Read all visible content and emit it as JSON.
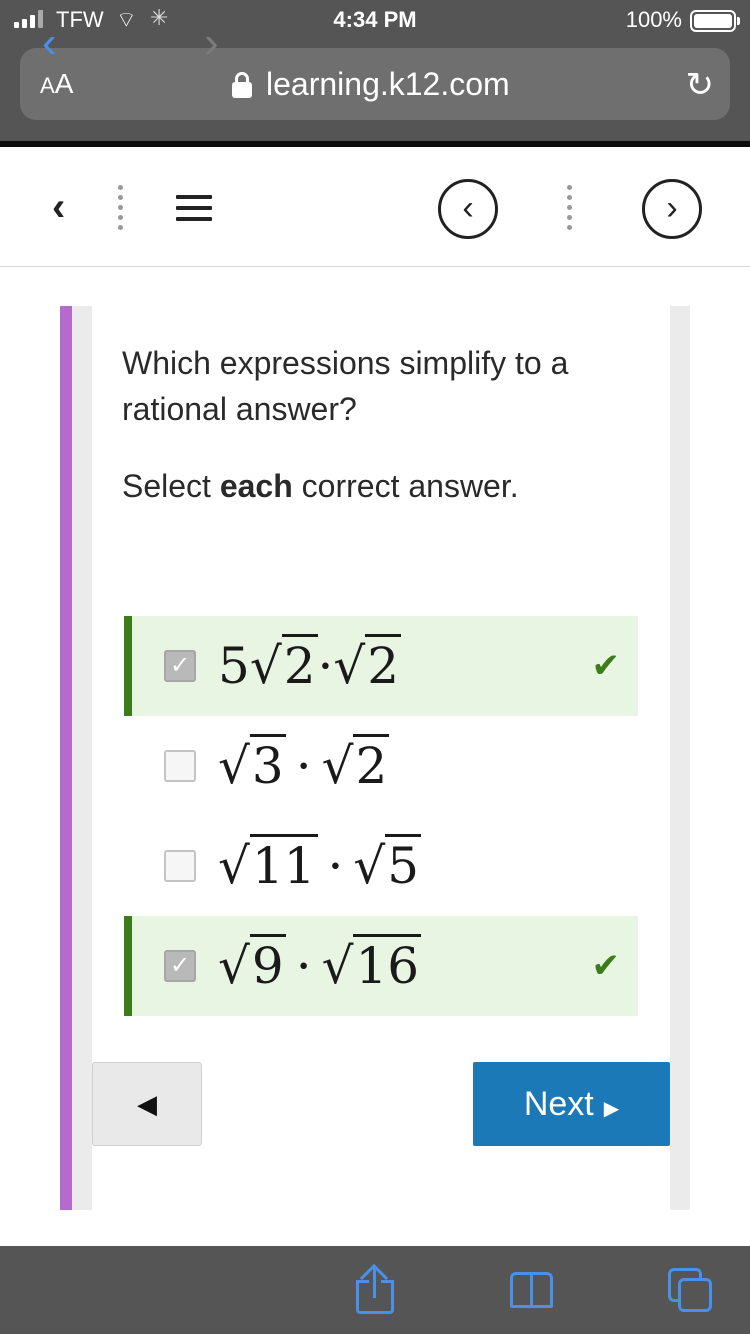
{
  "status_bar": {
    "carrier": "TFW",
    "time": "4:34 PM",
    "battery": "100%"
  },
  "browser": {
    "text_size_label": "AA",
    "url": "learning.k12.com"
  },
  "app_toolbar": {
    "icons": [
      "chevron-left-icon",
      "menu-icon",
      "circle-prev-icon",
      "circle-next-icon"
    ]
  },
  "question": {
    "text": "Which expressions simplify to a rational answer?",
    "instruction_prefix": "Select ",
    "instruction_bold": "each",
    "instruction_suffix": " correct answer."
  },
  "options": [
    {
      "coef": "5",
      "a": "2",
      "b": "2",
      "checked": true,
      "correct": true
    },
    {
      "coef": "",
      "a": "3",
      "b": "2",
      "checked": false,
      "correct": false
    },
    {
      "coef": "",
      "a": "11",
      "b": "5",
      "checked": false,
      "correct": false
    },
    {
      "coef": "",
      "a": "9",
      "b": "16",
      "checked": true,
      "correct": true
    }
  ],
  "navigation": {
    "prev_label": "◀",
    "next_label": "Next",
    "next_arrow": "▶"
  },
  "colors": {
    "accent": "#b46bcd",
    "correct_green": "#3a7d1a",
    "next_blue": "#1c79b7"
  }
}
